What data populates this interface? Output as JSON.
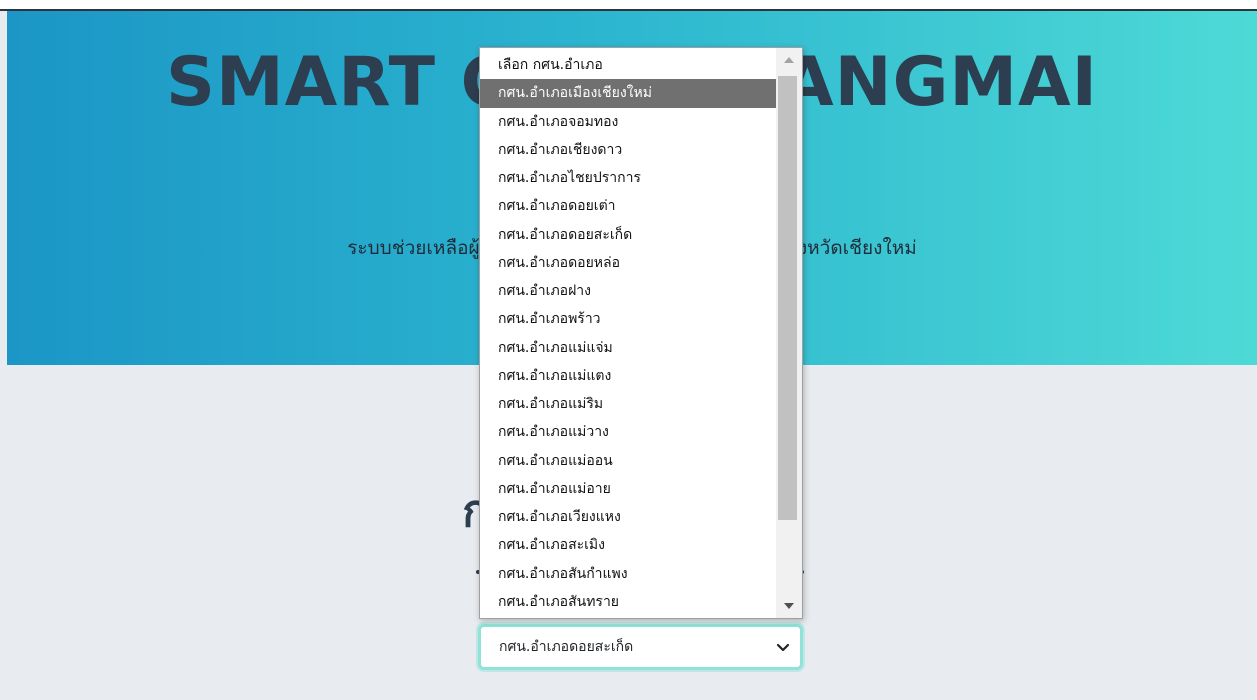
{
  "hero": {
    "title": "SMART OCC CHIANGMAI",
    "subtitle": "ระบบช่วยเหลือผู้เรียน ข้อมูลนักศึกษา สำนักงาน กศน. จังหวัดเชียงใหม่"
  },
  "section": {
    "title": "กรุณาเลือกอำเภอ"
  },
  "select": {
    "value": "กศน.อำเภอดอยสะเก็ด"
  },
  "dropdown": {
    "options": [
      "เลือก กศน.อำเภอ",
      "กศน.อำเภอเมืองเชียงใหม่",
      "กศน.อำเภอจอมทอง",
      "กศน.อำเภอเชียงดาว",
      "กศน.อำเภอไชยปราการ",
      "กศน.อำเภอดอยเต่า",
      "กศน.อำเภอดอยสะเก็ด",
      "กศน.อำเภอดอยหล่อ",
      "กศน.อำเภอฝาง",
      "กศน.อำเภอพร้าว",
      "กศน.อำเภอแม่แจ่ม",
      "กศน.อำเภอแม่แตง",
      "กศน.อำเภอแม่ริม",
      "กศน.อำเภอแม่วาง",
      "กศน.อำเภอแม่ออน",
      "กศน.อำเภอแม่อาย",
      "กศน.อำเภอเวียงแหง",
      "กศน.อำเภอสะเมิง",
      "กศน.อำเภอสันกำแพง",
      "กศน.อำเภอสันทราย"
    ],
    "highlighted_index": 1,
    "scroll_fraction": 0.78
  },
  "icons": {
    "select_chevron": "chevron-down-icon",
    "scroll_up": "triangle-up-icon",
    "scroll_down": "triangle-down-icon"
  },
  "colors": {
    "hero_gradient_start": "#1b96c6",
    "hero_gradient_end": "#4ddad6",
    "heading": "#2c3e50",
    "page_background": "#e8ebef",
    "select_focus_border": "#8fe3d9",
    "option_highlight": "#707070"
  }
}
